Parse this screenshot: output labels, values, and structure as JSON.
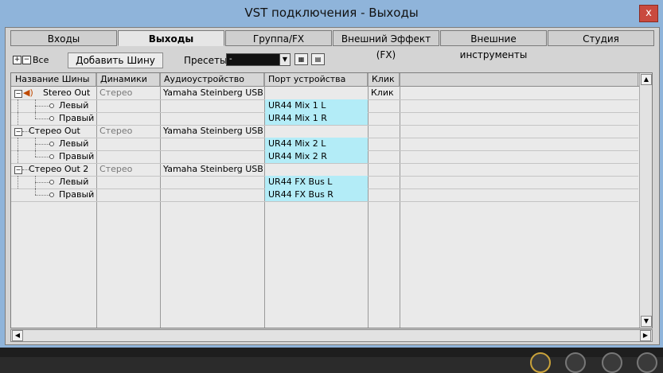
{
  "window": {
    "title": "VST подключения - Выходы",
    "close_label": "x"
  },
  "tabs": [
    {
      "label": "Входы",
      "active": false
    },
    {
      "label": "Выходы",
      "active": true
    },
    {
      "label": "Группа/FX",
      "active": false
    },
    {
      "label": "Внешний Эффект (FX)",
      "active": false
    },
    {
      "label": "Внешние инструменты",
      "active": false
    },
    {
      "label": "Студия",
      "active": false
    }
  ],
  "toolbar": {
    "expand_all_icon": "plus-box-icon",
    "collapse_all_icon": "minus-box-icon",
    "all_label": "Все",
    "add_bus_label": "Добавить Шину",
    "presets_label": "Пресеты",
    "preset_value": "-",
    "store_preset_icon": "store-preset-icon",
    "remove_preset_icon": "remove-preset-icon"
  },
  "table": {
    "columns": [
      "Название Шины",
      "Динамики",
      "Аудиоустройство",
      "Порт устройства",
      "Клик",
      ""
    ],
    "rows": [
      {
        "type": "bus",
        "name": "Stereo Out",
        "speakers": "Стерео",
        "device": "Yamaha Steinberg USB A",
        "port": "",
        "click": "Клик",
        "has_speaker_icon": true
      },
      {
        "type": "channel",
        "name": "Левый",
        "speakers": "",
        "device": "",
        "port": "UR44 Mix 1 L",
        "click": ""
      },
      {
        "type": "channel",
        "name": "Правый",
        "speakers": "",
        "device": "",
        "port": "UR44 Mix 1 R",
        "click": ""
      },
      {
        "type": "bus",
        "name": "Стерео Out",
        "speakers": "Стерео",
        "device": "Yamaha Steinberg USB A",
        "port": "",
        "click": "",
        "has_speaker_icon": false
      },
      {
        "type": "channel",
        "name": "Левый",
        "speakers": "",
        "device": "",
        "port": "UR44 Mix 2 L",
        "click": ""
      },
      {
        "type": "channel",
        "name": "Правый",
        "speakers": "",
        "device": "",
        "port": "UR44 Mix 2 R",
        "click": ""
      },
      {
        "type": "bus",
        "name": "Стерео Out 2",
        "speakers": "Стерео",
        "device": "Yamaha Steinberg USB A",
        "port": "",
        "click": "",
        "has_speaker_icon": false
      },
      {
        "type": "channel",
        "name": "Левый",
        "speakers": "",
        "device": "",
        "port": "UR44 FX Bus L",
        "click": ""
      },
      {
        "type": "channel",
        "name": "Правый",
        "speakers": "",
        "device": "",
        "port": "UR44 FX Bus R",
        "click": ""
      }
    ]
  },
  "colors": {
    "port_highlight": "#b3ecf7",
    "title_bar": "#8fb4da",
    "close_button": "#c94a3f"
  }
}
